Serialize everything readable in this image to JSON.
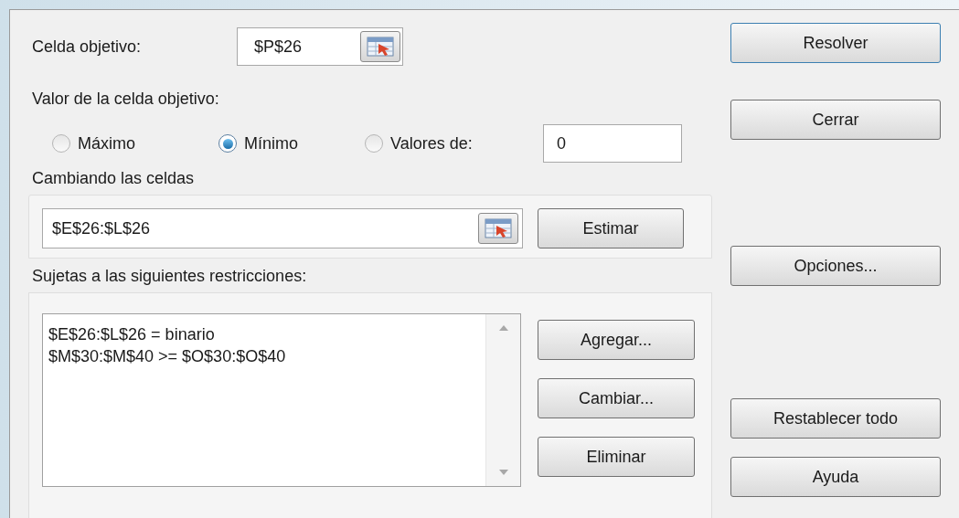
{
  "target_cell": {
    "label": "Celda objetivo:",
    "value": "$P$26"
  },
  "objective": {
    "label": "Valor de la celda objetivo:",
    "value": "0",
    "options": [
      {
        "label": "Máximo",
        "selected": false
      },
      {
        "label": "Mínimo",
        "selected": true
      },
      {
        "label": "Valores de:",
        "selected": false
      }
    ]
  },
  "changing_cells": {
    "label": "Cambiando las celdas",
    "value": "$E$26:$L$26",
    "button": "Estimar"
  },
  "constraints": {
    "label": "Sujetas a las siguientes restricciones:",
    "items": [
      "$E$26:$L$26 = binario",
      "$M$30:$M$40 >= $O$30:$O$40"
    ],
    "buttons": [
      "Agregar...",
      "Cambiar...",
      "Eliminar"
    ]
  },
  "side_buttons": [
    "Resolver",
    "Cerrar",
    "Opciones...",
    "Restablecer todo",
    "Ayuda"
  ]
}
